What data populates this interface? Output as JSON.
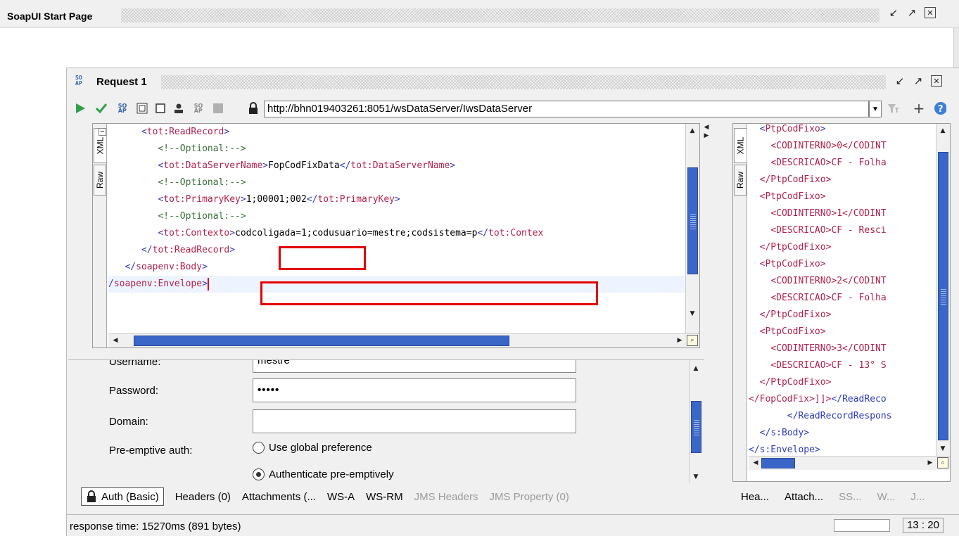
{
  "outer_window": {
    "title": "SoapUI Start Page"
  },
  "inner_window": {
    "logo": "SO AP",
    "title": "Request 1"
  },
  "toolbar": {
    "endpoint": "http://bhn019403261:8051/wsDataServer/IwsDataServer",
    "icons": [
      "run-icon",
      "submit-icon",
      "soap-icon",
      "create-empty-icon",
      "clone-icon",
      "user-icon",
      "soap-icon",
      "stop-icon",
      "lock-icon",
      "dropdown-icon",
      "filter-icon",
      "plus-icon",
      "help-icon"
    ]
  },
  "request_editor": {
    "tabs": [
      "XML",
      "Raw"
    ],
    "lines": [
      {
        "indent": "      ",
        "parts": [
          {
            "t": "<",
            "c": "brk"
          },
          {
            "t": "tot:ReadRecord",
            "c": "tag"
          },
          {
            "t": ">",
            "c": "brk"
          }
        ]
      },
      {
        "indent": "         ",
        "parts": [
          {
            "t": "<!--Optional:-->",
            "c": "com"
          }
        ]
      },
      {
        "indent": "         ",
        "parts": [
          {
            "t": "<",
            "c": "brk"
          },
          {
            "t": "tot:DataServerName",
            "c": "tag"
          },
          {
            "t": ">",
            "c": "brk"
          },
          {
            "t": "FopCodFixData",
            "c": "txt"
          },
          {
            "t": "</",
            "c": "brk"
          },
          {
            "t": "tot:DataServerName",
            "c": "tag"
          },
          {
            "t": ">",
            "c": "brk"
          }
        ]
      },
      {
        "indent": "         ",
        "parts": [
          {
            "t": "<!--Optional:-->",
            "c": "com"
          }
        ]
      },
      {
        "indent": "         ",
        "parts": [
          {
            "t": "<",
            "c": "brk"
          },
          {
            "t": "tot:PrimaryKey",
            "c": "tag"
          },
          {
            "t": ">",
            "c": "brk"
          },
          {
            "t": "1;00001;002",
            "c": "txt"
          },
          {
            "t": "</",
            "c": "brk"
          },
          {
            "t": "tot:PrimaryKey",
            "c": "tag"
          },
          {
            "t": ">",
            "c": "brk"
          }
        ]
      },
      {
        "indent": "         ",
        "parts": [
          {
            "t": "<!--Optional:-->",
            "c": "com"
          }
        ]
      },
      {
        "indent": "         ",
        "parts": [
          {
            "t": "<",
            "c": "brk"
          },
          {
            "t": "tot:Contexto",
            "c": "tag"
          },
          {
            "t": ">",
            "c": "brk"
          },
          {
            "t": "codcoligada=1;codusuario=mestre;codsistema=p",
            "c": "txt"
          },
          {
            "t": "</",
            "c": "brk"
          },
          {
            "t": "tot:Contex",
            "c": "tag"
          }
        ]
      },
      {
        "indent": "      ",
        "parts": [
          {
            "t": "</",
            "c": "brk"
          },
          {
            "t": "tot:ReadRecord",
            "c": "tag"
          },
          {
            "t": ">",
            "c": "brk"
          }
        ]
      },
      {
        "indent": "   ",
        "parts": [
          {
            "t": "</",
            "c": "brk"
          },
          {
            "t": "soapenv:Body",
            "c": "tag"
          },
          {
            "t": ">",
            "c": "brk"
          }
        ]
      },
      {
        "indent": "",
        "parts": [
          {
            "t": "/",
            "c": "brk"
          },
          {
            "t": "soapenv:Envelope",
            "c": "tag"
          },
          {
            "t": ">",
            "c": "brk"
          }
        ]
      }
    ]
  },
  "auth": {
    "username_label": "Username:",
    "username_value": "mestre",
    "password_label": "Password:",
    "password_value": "•••••",
    "domain_label": "Domain:",
    "domain_value": "",
    "preemptive_label": "Pre-emptive auth:",
    "option_global": "Use global preference",
    "option_preemptive": "Authenticate pre-emptively",
    "selected_option": "Authenticate pre-emptively"
  },
  "request_tabs": {
    "auth": "Auth (Basic)",
    "headers": "Headers (0)",
    "attachments": "Attachments (...",
    "wsa": "WS-A",
    "wsrm": "WS-RM",
    "jms_headers": "JMS Headers",
    "jms_property": "JMS Property (0)"
  },
  "response_editor": {
    "tabs": [
      "XML",
      "Raw"
    ],
    "lines": [
      {
        "indent": "  ",
        "parts": [
          {
            "t": "<",
            "c": "brk"
          },
          {
            "t": "PtpCodFixo",
            "c": "tag"
          },
          {
            "t": ">",
            "c": "brk"
          }
        ]
      },
      {
        "indent": "    ",
        "parts": [
          {
            "t": "<CODINTERNO>0</CODINT",
            "c": "tag"
          }
        ]
      },
      {
        "indent": "    ",
        "parts": [
          {
            "t": "<DESCRICAO>CF - Folha",
            "c": "tag"
          }
        ]
      },
      {
        "indent": "  ",
        "parts": [
          {
            "t": "</PtpCodFixo>",
            "c": "tag"
          }
        ]
      },
      {
        "indent": "  ",
        "parts": [
          {
            "t": "<PtpCodFixo>",
            "c": "tag"
          }
        ]
      },
      {
        "indent": "    ",
        "parts": [
          {
            "t": "<CODINTERNO>1</CODINT",
            "c": "tag"
          }
        ]
      },
      {
        "indent": "    ",
        "parts": [
          {
            "t": "<DESCRICAO>CF - Resci",
            "c": "tag"
          }
        ]
      },
      {
        "indent": "  ",
        "parts": [
          {
            "t": "</PtpCodFixo>",
            "c": "tag"
          }
        ]
      },
      {
        "indent": "  ",
        "parts": [
          {
            "t": "<PtpCodFixo>",
            "c": "tag"
          }
        ]
      },
      {
        "indent": "    ",
        "parts": [
          {
            "t": "<CODINTERNO>2</CODINT",
            "c": "tag"
          }
        ]
      },
      {
        "indent": "    ",
        "parts": [
          {
            "t": "<DESCRICAO>CF - Folha",
            "c": "tag"
          }
        ]
      },
      {
        "indent": "  ",
        "parts": [
          {
            "t": "</PtpCodFixo>",
            "c": "tag"
          }
        ]
      },
      {
        "indent": "  ",
        "parts": [
          {
            "t": "<PtpCodFixo>",
            "c": "tag"
          }
        ]
      },
      {
        "indent": "    ",
        "parts": [
          {
            "t": "<CODINTERNO>3</CODINT",
            "c": "tag"
          }
        ]
      },
      {
        "indent": "    ",
        "parts": [
          {
            "t": "<DESCRICAO>CF - 13° S",
            "c": "tag"
          }
        ]
      },
      {
        "indent": "  ",
        "parts": [
          {
            "t": "</PtpCodFixo>",
            "c": "tag"
          }
        ]
      },
      {
        "indent": "",
        "parts": [
          {
            "t": "</FopCodFix>",
            "c": "tag"
          },
          {
            "t": "]]>",
            "c": "tag"
          },
          {
            "t": "</",
            "c": "brk"
          },
          {
            "t": "ReadReco",
            "c": "brk"
          }
        ]
      },
      {
        "indent": "       ",
        "parts": [
          {
            "t": "</",
            "c": "brk"
          },
          {
            "t": "ReadRecordRespons",
            "c": "brk"
          }
        ]
      },
      {
        "indent": "  ",
        "parts": [
          {
            "t": "</",
            "c": "brk"
          },
          {
            "t": "s:Body",
            "c": "brk"
          },
          {
            "t": ">",
            "c": "brk"
          }
        ]
      },
      {
        "indent": "",
        "parts": [
          {
            "t": "</",
            "c": "brk"
          },
          {
            "t": "s:Envelope",
            "c": "brk"
          },
          {
            "t": ">",
            "c": "brk"
          }
        ]
      }
    ]
  },
  "response_tabs": [
    "Hea...",
    "Attach...",
    "SS...",
    "W...",
    "J..."
  ],
  "status": {
    "text": "response time: 15270ms (891 bytes)",
    "position": "13 : 20"
  },
  "colors": {
    "tag": "#b2224a",
    "bracket": "#2e3bc4",
    "comment": "#3a6f3a",
    "scroll_thumb": "#3a66c8",
    "highlight_box": "#e30000"
  }
}
